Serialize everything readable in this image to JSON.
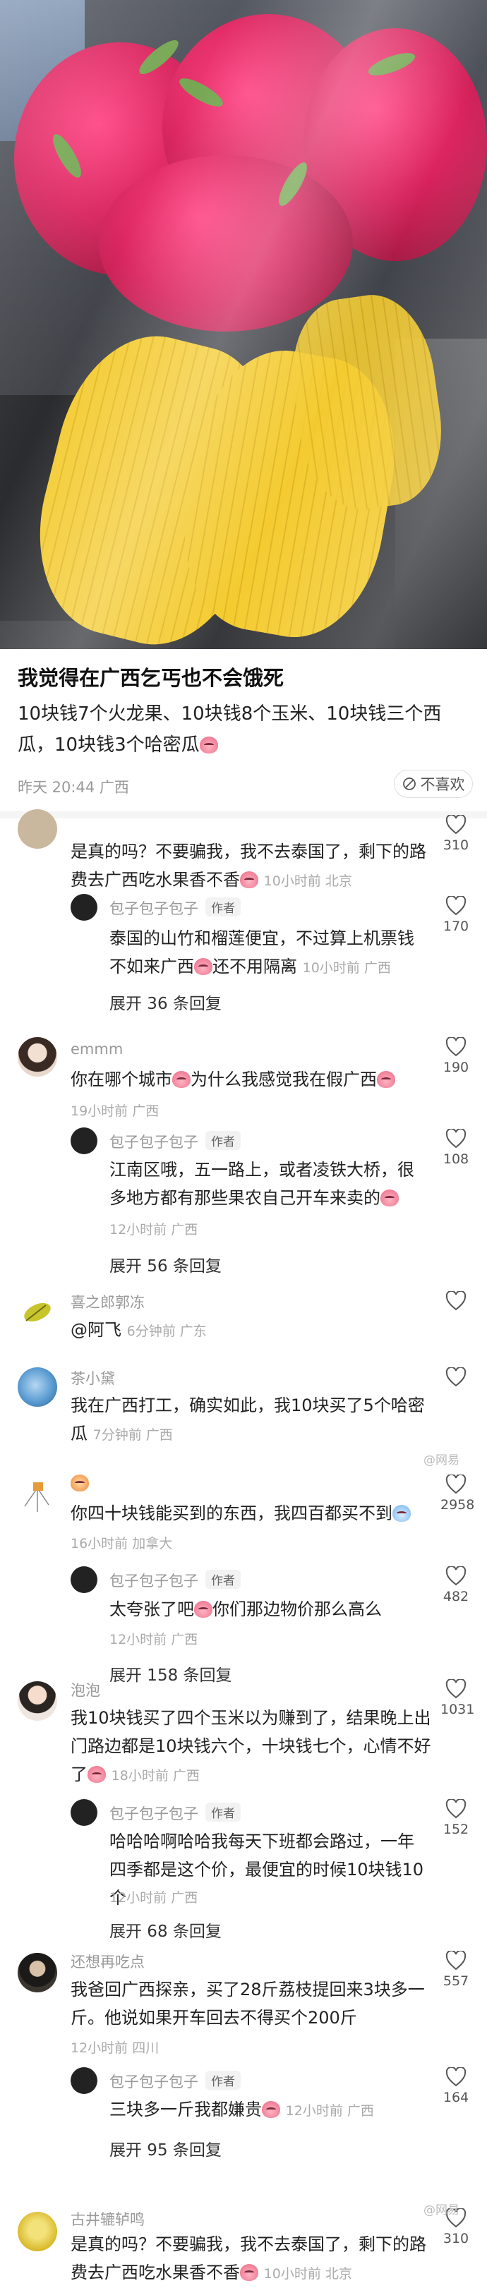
{
  "post": {
    "title": "我觉得在广西乞丐也不会饿死",
    "body": "10块钱7个火龙果、10块钱8个玉米、10块钱三个西瓜，10块钱3个哈密瓜",
    "meta": "昨天 20:44 广西",
    "dislike_label": "不喜欢"
  },
  "comments": [
    {
      "user": "",
      "text": "是真的吗？不要骗我，我不去泰国了，剩下的路费去广西吃水果香不香",
      "time": "10小时前 北京",
      "likes": "310",
      "replies": [
        {
          "user": "包子包子包子",
          "tag": "作者",
          "text": "泰国的山竹和榴莲便宜，不过算上机票钱不如来广西",
          "text2": "还不用隔离",
          "time": "10小时前 广西",
          "likes": "170"
        }
      ],
      "expand": "展开 36 条回复"
    },
    {
      "user": "emmm",
      "text": "你在哪个城市",
      "text2": "为什么我感觉我在假广西",
      "time": "19小时前 广西",
      "likes": "190",
      "replies": [
        {
          "user": "包子包子包子",
          "tag": "作者",
          "text": "江南区哦，五一路上，或者凌铁大桥，很多地方都有那些果农自己开车来卖的",
          "time": "12小时前 广西",
          "likes": "108"
        }
      ],
      "expand": "展开 56 条回复"
    },
    {
      "user": "喜之郎郭冻",
      "text": "@阿飞",
      "time": "6分钟前 广东",
      "likes": ""
    },
    {
      "user": "茶小黛",
      "text": "我在广西打工，确实如此，我10块买了5个哈密瓜",
      "time": "7分钟前 广西",
      "likes": ""
    },
    {
      "user": "",
      "text": "你四十块钱能买到的东西，我四百都买不到",
      "time": "16小时前 加拿大",
      "likes": "2958",
      "replies": [
        {
          "user": "包子包子包子",
          "tag": "作者",
          "text": "太夸张了吧",
          "text2": "你们那边物价那么高么",
          "time": "12小时前 广西",
          "likes": "482"
        }
      ],
      "expand": "展开 158 条回复"
    },
    {
      "user": "泡泡",
      "text": "我10块钱买了四个玉米以为赚到了，结果晚上出门路边都是10块钱六个，十块钱七个，心情不好了",
      "time": "18小时前 广西",
      "likes": "1031",
      "replies": [
        {
          "user": "包子包子包子",
          "tag": "作者",
          "text": "哈哈哈啊哈哈我每天下班都会路过，一年四季都是这个价，最便宜的时候10块钱10个",
          "time": "12小时前 广西",
          "likes": "152"
        }
      ],
      "expand": "展开 68 条回复"
    },
    {
      "user": "还想再吃点",
      "text": "我爸回广西探亲，买了28斤荔枝提回来3块多一斤。他说如果开车回去不得买个200斤",
      "time": "12小时前 四川",
      "likes": "557",
      "replies": [
        {
          "user": "包子包子包子",
          "tag": "作者",
          "text": "三块多一斤我都嫌贵",
          "time": "12小时前 广西",
          "likes": "164"
        }
      ],
      "expand": "展开 95 条回复"
    },
    {
      "user": "古井辘轳鸣",
      "text": "是真的吗？不要骗我，我不去泰国了，剩下的路费去广西吃水果香不香",
      "time": "10小时前 北京",
      "likes": "310"
    }
  ],
  "watermark": "@网易"
}
